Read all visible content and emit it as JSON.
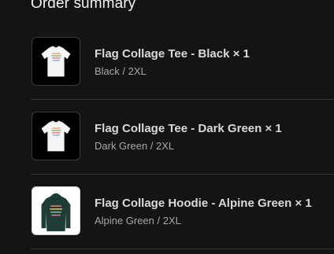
{
  "summary": {
    "title": "Order summary"
  },
  "items": [
    {
      "name": "Flag Collage Tee - Black × 1",
      "variant": "Black / 2XL",
      "thumbnail_icon": "tshirt-icon",
      "garment_color": "#f4f4f4",
      "thumb_bg": "#000000"
    },
    {
      "name": "Flag Collage Tee - Dark Green × 1",
      "variant": "Dark Green / 2XL",
      "thumbnail_icon": "tshirt-icon",
      "garment_color": "#f4f4f4",
      "thumb_bg": "#000000"
    },
    {
      "name": "Flag Collage Hoodie - Alpine Green × 1",
      "variant": "Alpine Green / 2XL",
      "thumbnail_icon": "hoodie-icon",
      "garment_color": "#1f3d36",
      "thumb_bg": "#ffffff"
    }
  ]
}
